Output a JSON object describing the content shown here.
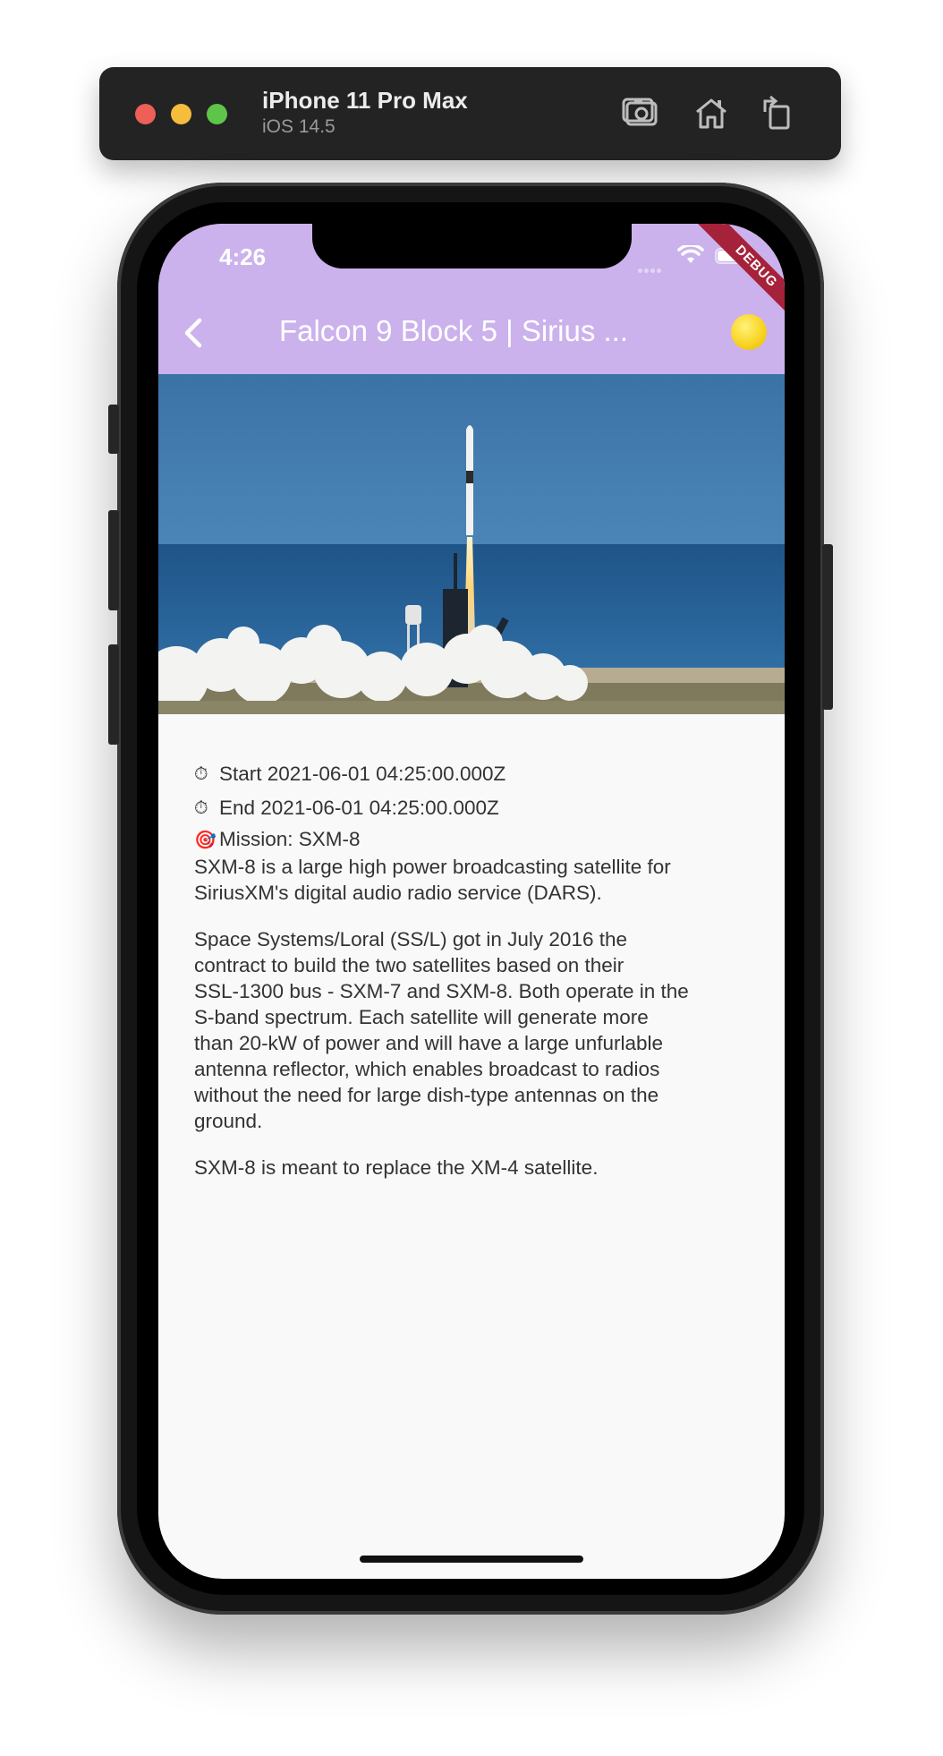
{
  "simulator": {
    "device_name": "iPhone 11 Pro Max",
    "os_version": "iOS 14.5",
    "toolbar_icons": [
      "screenshot-icon",
      "home-icon",
      "rotate-icon"
    ]
  },
  "status_bar": {
    "time": "4:26",
    "debug_banner": "DEBUG"
  },
  "app_bar": {
    "title": "Falcon 9 Block 5 | Sirius ...",
    "background": "#cbb2ec",
    "back_icon": "chevron-left-icon",
    "action_icon": "sun-icon"
  },
  "launch": {
    "image": "rocket-launch-photo",
    "start_icon": "⏱",
    "start_text": "Start 2021-06-01 04:25:00.000Z",
    "end_icon": "⏱",
    "end_text": "End 2021-06-01 04:25:00.000Z",
    "mission_icon": "🎯",
    "mission_text": "Mission: SXM-8",
    "paragraphs": [
      "SXM-8 is a large high power broadcasting satellite for\nSiriusXM's digital audio radio service (DARS).",
      "Space Systems/Loral (SS/L) got in July 2016 the\ncontract to build the two satellites based on their\nSSL-1300 bus - SXM-7 and SXM-8. Both operate in the\nS-band spectrum. Each satellite will generate more\nthan 20-kW of power and will have a large unfurlable\nantenna reflector, which enables broadcast to radios\nwithout the need for large dish-type antennas on the\nground.",
      "SXM-8 is meant to replace the XM-4 satellite."
    ]
  }
}
